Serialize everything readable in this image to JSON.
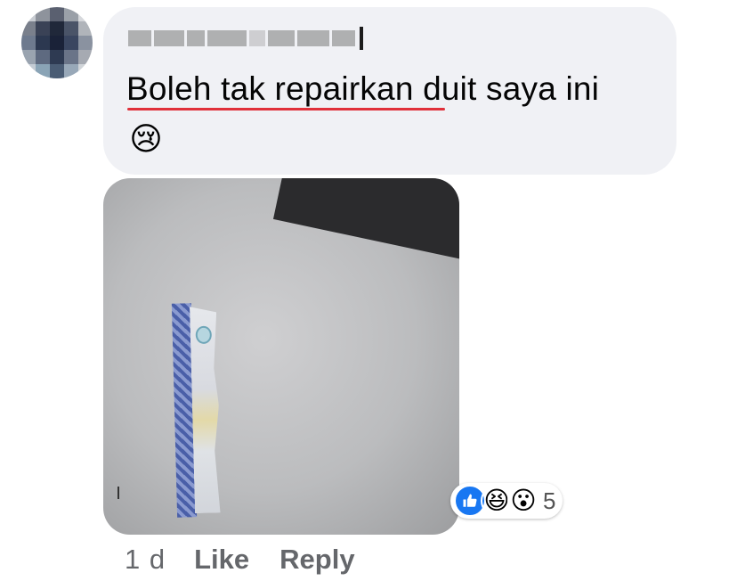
{
  "comment": {
    "author_name": "",
    "text": "Boleh tak repairkan duit saya ini",
    "emoji": "😢",
    "emoji_name": "crying-face-icon"
  },
  "attachment": {
    "type": "photo"
  },
  "reactions": {
    "icons": [
      "like-icon",
      "haha-icon",
      "wow-icon"
    ],
    "count": "5",
    "like_color": "#1877f2"
  },
  "actions": {
    "time": "1 d",
    "like_label": "Like",
    "reply_label": "Reply"
  },
  "colors": {
    "bubble_bg": "#f0f1f5",
    "text": "#050505",
    "secondary": "#65676b",
    "spellcheck": "#e0303a"
  }
}
